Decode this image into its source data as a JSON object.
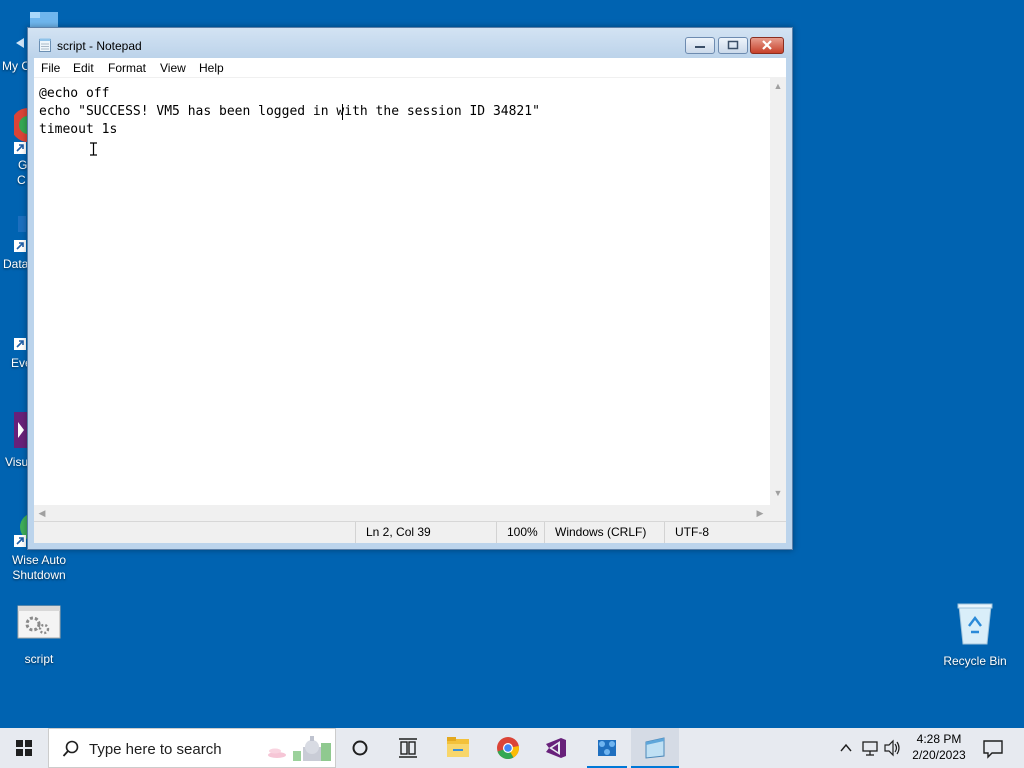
{
  "desktop": {
    "partial_icons": [
      {
        "label": "My C"
      },
      {
        "label": "G"
      },
      {
        "label": "C"
      },
      {
        "label": "Data"
      },
      {
        "label": "Eve"
      },
      {
        "label": "Visu"
      }
    ],
    "icons": [
      {
        "label_line1": "Wise Auto",
        "label_line2": "Shutdown"
      },
      {
        "label": "script"
      },
      {
        "label": "Recycle Bin"
      }
    ]
  },
  "notepad": {
    "title": "script - Notepad",
    "menu": [
      "File",
      "Edit",
      "Format",
      "View",
      "Help"
    ],
    "content_lines": [
      "@echo off",
      "echo \"SUCCESS! VM5 has been logged in with the session ID 34821\"",
      "timeout 1s"
    ],
    "status": {
      "position": "Ln 2, Col 39",
      "zoom": "100%",
      "line_ending": "Windows (CRLF)",
      "encoding": "UTF-8"
    }
  },
  "taskbar": {
    "search_placeholder": "Type here to search",
    "apps": [
      "task-view",
      "file-explorer",
      "chrome",
      "visual-studio",
      "azure-data-studio",
      "notepad"
    ],
    "clock": {
      "time": "4:28 PM",
      "date": "2/20/2023"
    }
  },
  "colors": {
    "desktop_bg": "#0063b1",
    "taskbar_bg": "#e7eaf0",
    "accent": "#0078d7"
  }
}
